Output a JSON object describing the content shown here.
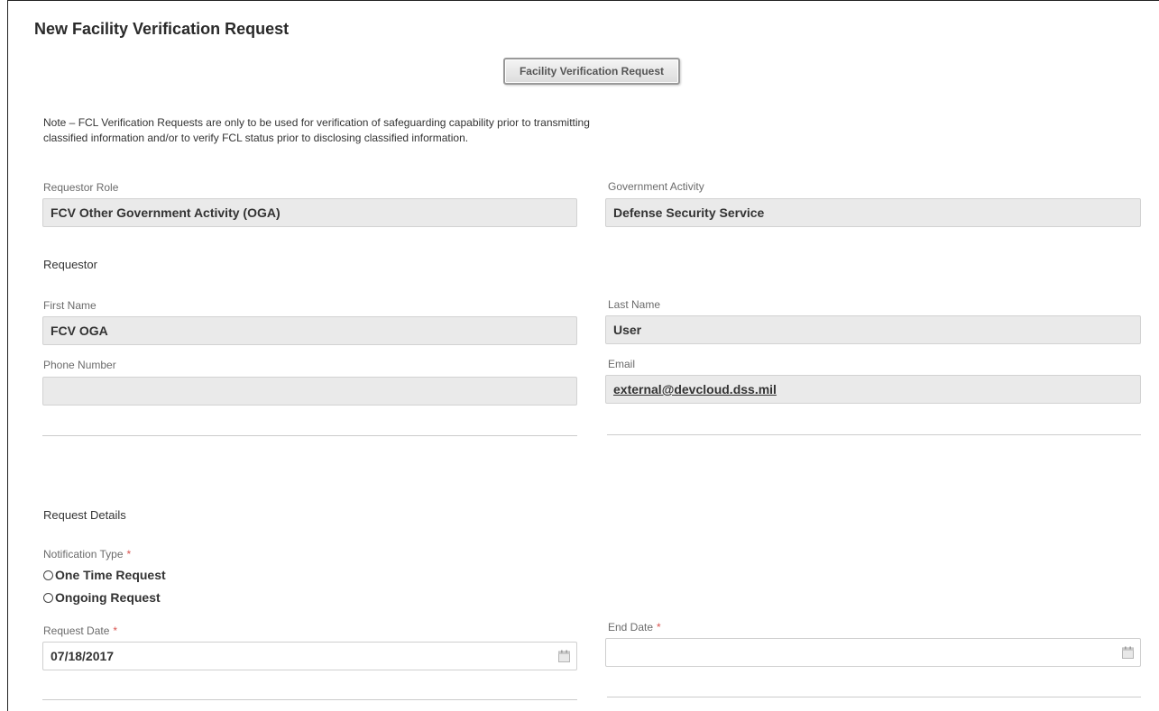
{
  "page": {
    "title": "New Facility Verification Request",
    "header_button": "Facility Verification Request",
    "note": "Note – FCL Verification Requests are only to be used for verification of safeguarding capability prior to transmitting classified information and/or to verify FCL status prior to disclosing classified information."
  },
  "requestor_role": {
    "label": "Requestor Role",
    "value": "FCV Other Government Activity (OGA)"
  },
  "government_activity": {
    "label": "Government Activity",
    "value": "Defense Security Service"
  },
  "requestor": {
    "section_label": "Requestor",
    "first_name": {
      "label": "First Name",
      "value": "FCV OGA"
    },
    "last_name": {
      "label": "Last Name",
      "value": "User"
    },
    "phone": {
      "label": "Phone Number",
      "value": ""
    },
    "email": {
      "label": "Email",
      "value": "external@devcloud.dss.mil"
    }
  },
  "request_details": {
    "section_label": "Request Details",
    "notification_type": {
      "label": "Notification Type",
      "required_mark": "*",
      "options": [
        "One Time Request",
        "Ongoing Request"
      ]
    },
    "request_date": {
      "label": "Request Date",
      "required_mark": "*",
      "value": "07/18/2017"
    },
    "end_date": {
      "label": "End Date",
      "required_mark": "*",
      "value": ""
    }
  },
  "colors": {
    "required": "#d9534f",
    "field_bg": "#eaeaea",
    "divider": "#cccccc"
  },
  "icons": {
    "date_picker": "calendar-icon"
  }
}
